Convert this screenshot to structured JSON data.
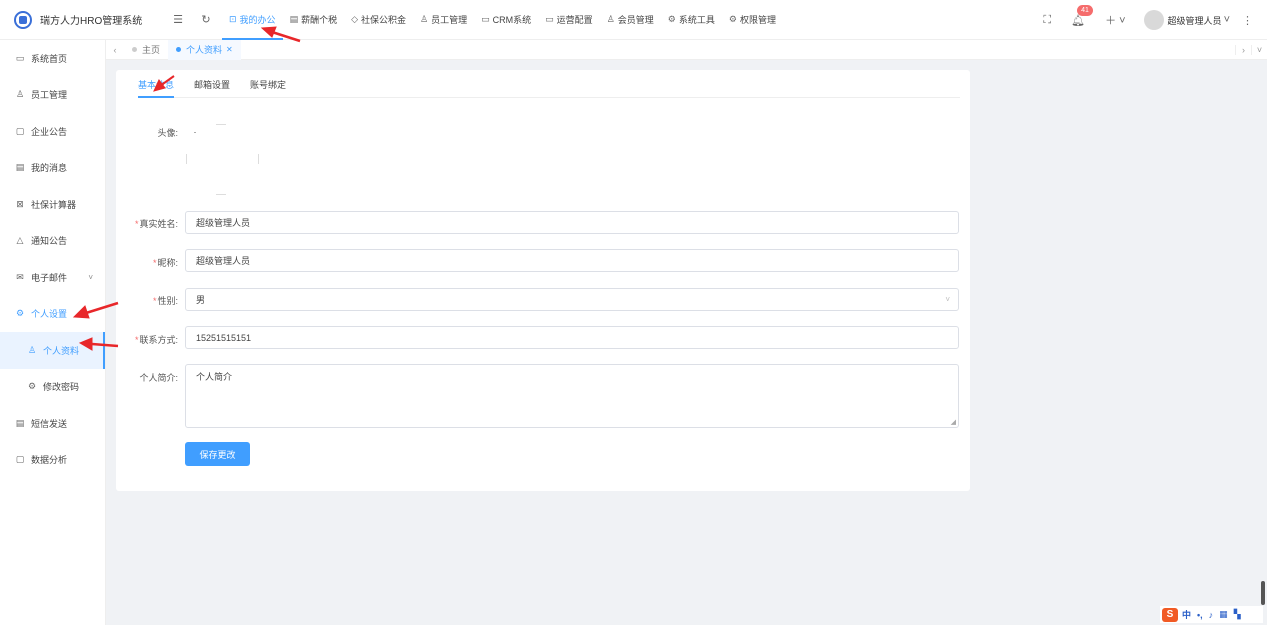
{
  "header": {
    "app_title": "瑞方人力HRO管理系统",
    "nav": [
      {
        "label": "我的办公",
        "icon": "briefcase-icon",
        "active": true
      },
      {
        "label": "薪酬个税",
        "icon": "document-icon"
      },
      {
        "label": "社保公积金",
        "icon": "shield-icon"
      },
      {
        "label": "员工管理",
        "icon": "users-icon"
      },
      {
        "label": "CRM系统",
        "icon": "folder-icon"
      },
      {
        "label": "运营配置",
        "icon": "card-icon"
      },
      {
        "label": "会员管理",
        "icon": "user-icon"
      },
      {
        "label": "系统工具",
        "icon": "tools-icon"
      },
      {
        "label": "权限管理",
        "icon": "gear-icon"
      }
    ],
    "notification_count": "41",
    "user_name": "超级管理人员"
  },
  "sidebar": {
    "items": [
      {
        "label": "系统首页",
        "icon": "monitor-icon"
      },
      {
        "label": "员工管理",
        "icon": "users-icon"
      },
      {
        "label": "企业公告",
        "icon": "chat-icon"
      },
      {
        "label": "我的消息",
        "icon": "message-icon"
      },
      {
        "label": "社保计算器",
        "icon": "calculator-icon"
      },
      {
        "label": "通知公告",
        "icon": "bell-icon"
      },
      {
        "label": "电子邮件",
        "icon": "mail-icon"
      },
      {
        "label": "个人设置",
        "icon": "settings-icon"
      },
      {
        "label": "个人资料",
        "icon": "user-icon"
      },
      {
        "label": "修改密码",
        "icon": "lock-icon"
      },
      {
        "label": "短信发送",
        "icon": "sms-icon"
      },
      {
        "label": "数据分析",
        "icon": "chart-icon"
      }
    ]
  },
  "tabs": [
    {
      "label": "主页"
    },
    {
      "label": "个人资料",
      "active": true
    }
  ],
  "profile": {
    "subtabs": [
      "基本信息",
      "邮箱设置",
      "账号绑定"
    ],
    "avatar_label": "头像:",
    "real_name_label": "真实姓名:",
    "real_name_value": "超级管理人员",
    "nickname_label": "昵称:",
    "nickname_value": "超级管理人员",
    "gender_label": "性别:",
    "gender_value": "男",
    "contact_label": "联系方式:",
    "contact_value": "15251515151",
    "bio_label": "个人简介:",
    "bio_placeholder": "个人简介",
    "save_label": "保存更改"
  },
  "colors": {
    "accent": "#409eff",
    "required": "#f56c6c",
    "arrow": "#e8272a"
  }
}
